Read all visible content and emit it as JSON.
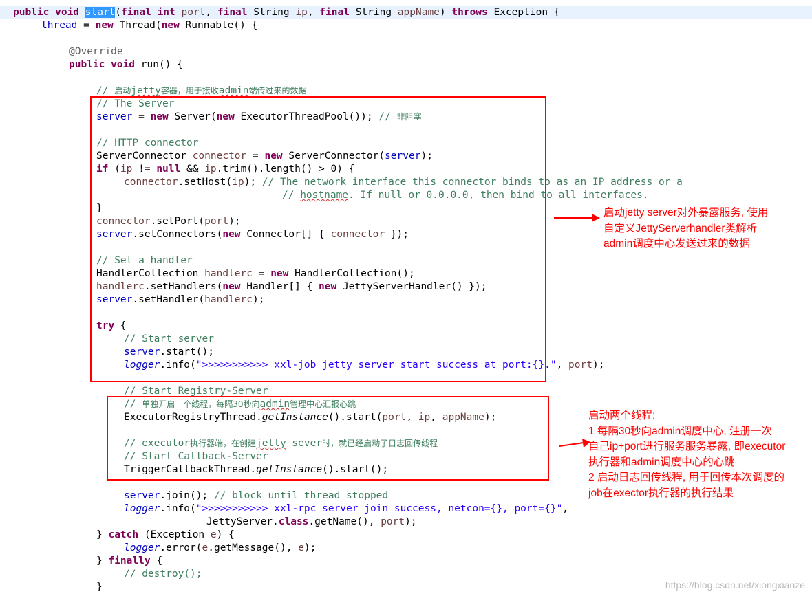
{
  "code": {
    "method_name": "start",
    "lines": [
      {
        "tokens": [
          [
            "kw",
            "public void "
          ],
          [
            "sel",
            "start"
          ],
          [
            "",
            "("
          ],
          [
            "kw",
            "final int "
          ],
          [
            "var",
            "port"
          ],
          [
            "",
            ", "
          ],
          [
            "kw",
            "final "
          ],
          [
            "",
            "String "
          ],
          [
            "var",
            "ip"
          ],
          [
            "",
            ", "
          ],
          [
            "kw",
            "final "
          ],
          [
            "",
            "String "
          ],
          [
            "var",
            "appName"
          ],
          [
            "",
            ") "
          ],
          [
            "kw",
            "throws "
          ],
          [
            "",
            "Exception {"
          ]
        ]
      },
      {
        "tokens": [
          [
            "fld",
            "thread"
          ],
          [
            "",
            " = "
          ],
          [
            "kw",
            "new "
          ],
          [
            "",
            "Thread("
          ],
          [
            "kw",
            "new "
          ],
          [
            "",
            "Runnable() {"
          ]
        ]
      },
      {
        "tokens": []
      },
      {
        "tokens": [
          [
            "ann",
            "@Override"
          ]
        ]
      },
      {
        "tokens": [
          [
            "kw",
            "public void "
          ],
          [
            "",
            "run() {"
          ]
        ]
      },
      {
        "tokens": []
      },
      {
        "tokens": [
          [
            "cm",
            "// "
          ],
          [
            "cm cn",
            "启动"
          ],
          [
            "cm squiggle",
            "jetty"
          ],
          [
            "cm cn",
            "容器，用于接收"
          ],
          [
            "cm squiggle",
            "admin"
          ],
          [
            "cm cn",
            "端传过来的数据"
          ]
        ]
      },
      {
        "tokens": [
          [
            "cm",
            "// The Server"
          ]
        ]
      },
      {
        "tokens": [
          [
            "fld",
            "server"
          ],
          [
            "",
            " = "
          ],
          [
            "kw",
            "new "
          ],
          [
            "",
            "Server("
          ],
          [
            "kw",
            "new "
          ],
          [
            "",
            "ExecutorThreadPool()); "
          ],
          [
            "cm",
            "// "
          ],
          [
            "cm cn",
            "非阻塞"
          ]
        ]
      },
      {
        "tokens": []
      },
      {
        "tokens": [
          [
            "cm",
            "// HTTP connector"
          ]
        ]
      },
      {
        "tokens": [
          [
            "",
            "ServerConnector "
          ],
          [
            "var",
            "connector"
          ],
          [
            "",
            " = "
          ],
          [
            "kw",
            "new "
          ],
          [
            "",
            "ServerConnector("
          ],
          [
            "fld",
            "server"
          ],
          [
            "",
            ");"
          ]
        ]
      },
      {
        "tokens": [
          [
            "kw",
            "if "
          ],
          [
            "",
            "("
          ],
          [
            "var",
            "ip"
          ],
          [
            "",
            " != "
          ],
          [
            "kw",
            "null "
          ],
          [
            "",
            "&& "
          ],
          [
            "var",
            "ip"
          ],
          [
            "",
            ".trim().length() > 0) {"
          ]
        ]
      },
      {
        "tokens": [
          [
            "var",
            "connector"
          ],
          [
            "",
            ".setHost("
          ],
          [
            "var",
            "ip"
          ],
          [
            "",
            "); "
          ],
          [
            "cm",
            "// The network interface this connector binds to as an IP address or a"
          ]
        ]
      },
      {
        "tokens": [
          [
            "cm",
            "// "
          ],
          [
            "cm squiggle",
            "hostname"
          ],
          [
            "cm",
            ". If null or 0.0.0.0, then bind to all interfaces."
          ]
        ]
      },
      {
        "tokens": [
          [
            "",
            "}"
          ]
        ]
      },
      {
        "tokens": [
          [
            "var",
            "connector"
          ],
          [
            "",
            ".setPort("
          ],
          [
            "var",
            "port"
          ],
          [
            "",
            ");"
          ]
        ]
      },
      {
        "tokens": [
          [
            "fld",
            "server"
          ],
          [
            "",
            ".setConnectors("
          ],
          [
            "kw",
            "new "
          ],
          [
            "",
            "Connector[] { "
          ],
          [
            "var",
            "connector"
          ],
          [
            "",
            " });"
          ]
        ]
      },
      {
        "tokens": []
      },
      {
        "tokens": [
          [
            "cm",
            "// Set a handler"
          ]
        ]
      },
      {
        "tokens": [
          [
            "",
            "HandlerCollection "
          ],
          [
            "var",
            "handlerc"
          ],
          [
            "",
            " = "
          ],
          [
            "kw",
            "new "
          ],
          [
            "",
            "HandlerCollection();"
          ]
        ]
      },
      {
        "tokens": [
          [
            "var",
            "handlerc"
          ],
          [
            "",
            ".setHandlers("
          ],
          [
            "kw",
            "new "
          ],
          [
            "",
            "Handler[] { "
          ],
          [
            "kw",
            "new "
          ],
          [
            "",
            "JettyServerHandler() });"
          ]
        ]
      },
      {
        "tokens": [
          [
            "fld",
            "server"
          ],
          [
            "",
            ".setHandler("
          ],
          [
            "var",
            "handlerc"
          ],
          [
            "",
            ");"
          ]
        ]
      },
      {
        "tokens": []
      },
      {
        "tokens": [
          [
            "kw",
            "try "
          ],
          [
            "",
            "{"
          ]
        ]
      },
      {
        "tokens": [
          [
            "cm",
            "// Start server"
          ]
        ]
      },
      {
        "tokens": [
          [
            "fld",
            "server"
          ],
          [
            "",
            ".start();"
          ]
        ]
      },
      {
        "tokens": [
          [
            "st",
            "logger"
          ],
          [
            "",
            ".info("
          ],
          [
            "str",
            "\">>>>>>>>>>> xxl-job jetty server start success at port:{}.\""
          ],
          [
            "",
            ", "
          ],
          [
            "var",
            "port"
          ],
          [
            "",
            ");"
          ]
        ]
      },
      {
        "tokens": []
      },
      {
        "tokens": [
          [
            "cm",
            "// Start Registry-Server"
          ]
        ]
      },
      {
        "tokens": [
          [
            "cm",
            "// "
          ],
          [
            "cm cn",
            "单独开启一个线程，每隔30秒向"
          ],
          [
            "cm squiggle",
            "admin"
          ],
          [
            "cm cn",
            "管理中心汇报心跳"
          ]
        ]
      },
      {
        "tokens": [
          [
            "",
            "ExecutorRegistryThread."
          ],
          [
            "it",
            "getInstance"
          ],
          [
            "",
            "().start("
          ],
          [
            "var",
            "port"
          ],
          [
            "",
            ", "
          ],
          [
            "var",
            "ip"
          ],
          [
            "",
            ", "
          ],
          [
            "var",
            "appName"
          ],
          [
            "",
            ");"
          ]
        ]
      },
      {
        "tokens": []
      },
      {
        "tokens": [
          [
            "cm",
            "// executor"
          ],
          [
            "cm cn",
            "执行器端，在创建"
          ],
          [
            "cm squiggle",
            "jetty"
          ],
          [
            "cm",
            " sever"
          ],
          [
            "cm cn",
            "时，就已经启动了日志回传线程"
          ]
        ]
      },
      {
        "tokens": [
          [
            "cm",
            "// Start Callback-Server"
          ]
        ]
      },
      {
        "tokens": [
          [
            "",
            "TriggerCallbackThread."
          ],
          [
            "it",
            "getInstance"
          ],
          [
            "",
            "().start();"
          ]
        ]
      },
      {
        "tokens": []
      },
      {
        "tokens": [
          [
            "fld",
            "server"
          ],
          [
            "",
            ".join(); "
          ],
          [
            "cm",
            "// block until thread stopped"
          ]
        ]
      },
      {
        "tokens": [
          [
            "st",
            "logger"
          ],
          [
            "",
            ".info("
          ],
          [
            "str",
            "\">>>>>>>>>>> xxl-rpc server join success, netcon={}, port={}\""
          ],
          [
            "",
            ","
          ]
        ]
      },
      {
        "tokens": [
          [
            "",
            "JettyServer."
          ],
          [
            "kw",
            "class"
          ],
          [
            "",
            ".getName(), "
          ],
          [
            "var",
            "port"
          ],
          [
            "",
            ");"
          ]
        ]
      },
      {
        "tokens": [
          [
            "",
            "} "
          ],
          [
            "kw",
            "catch "
          ],
          [
            "",
            "(Exception "
          ],
          [
            "var",
            "e"
          ],
          [
            "",
            ") {"
          ]
        ]
      },
      {
        "tokens": [
          [
            "st",
            "logger"
          ],
          [
            "",
            ".error("
          ],
          [
            "var",
            "e"
          ],
          [
            "",
            ".getMessage(), "
          ],
          [
            "var",
            "e"
          ],
          [
            "",
            ");"
          ]
        ]
      },
      {
        "tokens": [
          [
            "",
            "} "
          ],
          [
            "kw",
            "finally "
          ],
          [
            "",
            "{"
          ]
        ]
      },
      {
        "tokens": [
          [
            "cm",
            "// destroy();"
          ]
        ]
      },
      {
        "tokens": [
          [
            "",
            "}"
          ]
        ]
      }
    ]
  },
  "annotations": {
    "note1": "启动jetty server对外暴露服务, 使用\n自定义JettyServerhandler类解析\nadmin调度中心发送过来的数据",
    "note2": "启动两个线程:\n1 每隔30秒向admin调度中心, 注册一次\n自己ip+port进行服务服务暴露, 即executor\n执行器和admin调度中心的心跳\n2 启动日志回传线程, 用于回传本次调度的\njob在exector执行器的执行结果"
  },
  "colors": {
    "keyword": "#7f0055",
    "field": "#0000c0",
    "local_variable": "#6a3e3e",
    "comment": "#3f7f5f",
    "string": "#2a00ff",
    "annotation_red": "#ff0000",
    "selection": "#3399ff",
    "current_line": "#e8f2fe"
  },
  "watermark": "https://blog.csdn.net/xiongxianze"
}
